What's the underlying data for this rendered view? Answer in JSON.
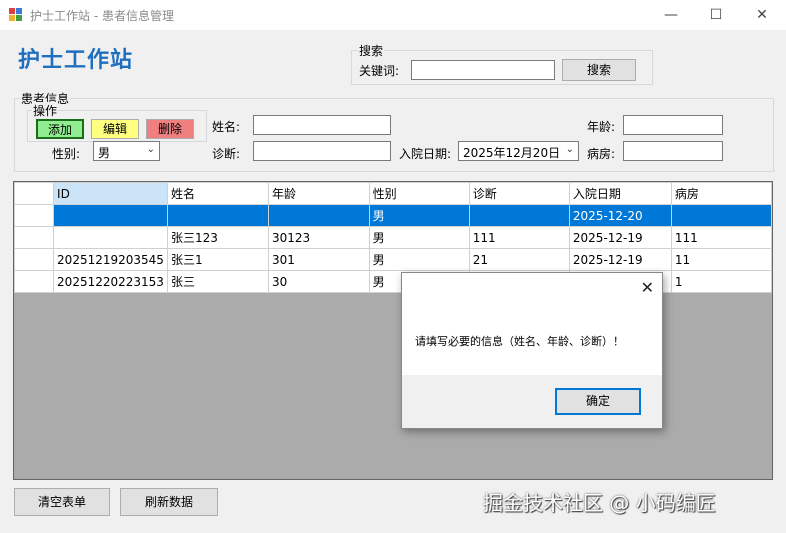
{
  "window": {
    "title": "护士工作站 - 患者信息管理",
    "minimize": "—",
    "maximize": "☐",
    "close": "✕"
  },
  "heading": "护士工作站",
  "search": {
    "group_label": "搜索",
    "keyword_label": "关键词:",
    "keyword_value": "",
    "button": "搜索"
  },
  "patient": {
    "group_label": "患者信息",
    "ops_label": "操作",
    "add": "添加",
    "edit": "编辑",
    "delete": "删除",
    "name_label": "姓名:",
    "name_value": "",
    "age_label": "年龄:",
    "age_value": "",
    "gender_label": "性别:",
    "gender_value": "男",
    "diagnosis_label": "诊断:",
    "diagnosis_value": "",
    "admit_label": "入院日期:",
    "admit_value": "2025年12月20日",
    "ward_label": "病房:",
    "ward_value": "",
    "colors": {
      "add": "#90ee90",
      "edit": "#ffff80",
      "delete": "#f08080"
    }
  },
  "grid": {
    "columns": [
      "ID",
      "姓名",
      "年龄",
      "性别",
      "诊断",
      "入院日期",
      "病房"
    ],
    "rows": [
      [
        "",
        "",
        "",
        "男",
        "",
        "2025-12-20",
        ""
      ],
      [
        "",
        "张三123",
        "30123",
        "男",
        "111",
        "2025-12-19",
        "111"
      ],
      [
        "20251219203545",
        "张三1",
        "301",
        "男",
        "21",
        "2025-12-19",
        "11"
      ],
      [
        "20251220223153",
        "张三",
        "30",
        "男",
        "",
        "",
        "1"
      ]
    ],
    "current_row_marker": "▶",
    "selection_color": "#0078d7"
  },
  "footer": {
    "clear": "清空表单",
    "refresh": "刷新数据"
  },
  "dialog": {
    "message": "请填写必要的信息（姓名、年龄、诊断）！",
    "ok": "确定",
    "close": "✕"
  },
  "watermark": "掘金技术社区 @ 小码编匠"
}
